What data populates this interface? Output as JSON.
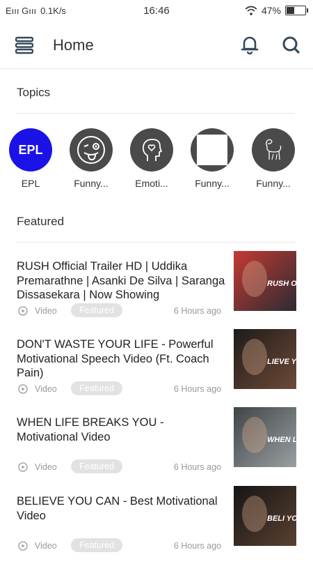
{
  "status_bar": {
    "carrier": "Eııı Gııı",
    "speed": "0.1K/s",
    "time": "16:46",
    "battery": "47%",
    "battery_level": 0.47
  },
  "app_bar": {
    "title": "Home",
    "icons": [
      "menu-icon",
      "bell-icon",
      "search-icon"
    ]
  },
  "topics_section": {
    "title": "Topics"
  },
  "topics": [
    {
      "label": "EPL",
      "badge": "EPL",
      "icon": "epl-badge"
    },
    {
      "label": "Funny...",
      "icon": "silly-face-icon"
    },
    {
      "label": "Emoti...",
      "icon": "head-heart-icon"
    },
    {
      "label": "Funny...",
      "icon": "square-icon"
    },
    {
      "label": "Funny...",
      "icon": "dog-sketch-icon"
    }
  ],
  "featured_section": {
    "title": "Featured"
  },
  "featured": [
    {
      "title": "RUSH Official Trailer HD | Uddika Premarathne | Asanki De Silva | Saranga Dissasekara | Now Showing",
      "type": "Video",
      "tag": "Featured",
      "time": "6 Hours ago",
      "thumb_text": "RUSH OFFICIAL TRAILER",
      "thumb_colors": [
        "#c43a32",
        "#2b2b33"
      ]
    },
    {
      "title": "DON'T WASTE YOUR LIFE - Powerful Motivational Speech Video (Ft. Coach Pain)",
      "type": "Video",
      "tag": "Featured",
      "time": "6 Hours ago",
      "thumb_text": "LIEVE YOU",
      "thumb_colors": [
        "#1f1b19",
        "#6d4a38"
      ]
    },
    {
      "title": "WHEN LIFE BREAKS YOU - Motivational Video",
      "type": "Video",
      "tag": "Featured",
      "time": "6 Hours ago",
      "thumb_text": "WHEN LIFE BREAKS",
      "thumb_colors": [
        "#3f4446",
        "#9aa0a2"
      ]
    },
    {
      "title": "BELIEVE YOU CAN - Best Motivational Video",
      "type": "Video",
      "tag": "Featured",
      "time": "6 Hours ago",
      "thumb_text": "BELI YOU C",
      "thumb_colors": [
        "#151515",
        "#5a4030"
      ]
    }
  ]
}
